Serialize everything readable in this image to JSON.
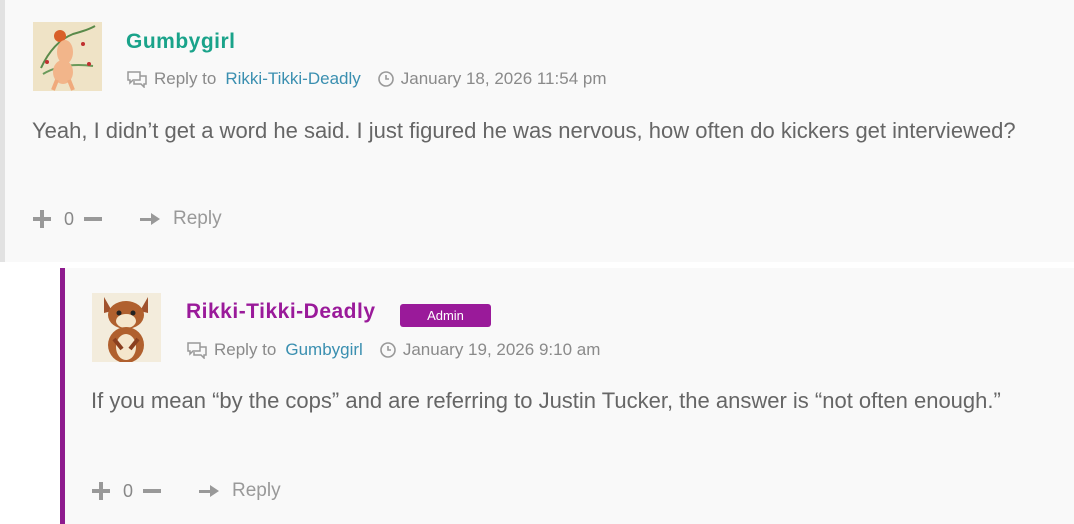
{
  "comments": [
    {
      "author": "Gumbygirl",
      "author_color": "#1aa38a",
      "reply_prefix": "Reply to",
      "reply_to": "Rikki-Tikki-Deadly",
      "date": "January 18, 2026 11:54 pm",
      "text": "Yeah, I didn’t get a word he said. I just figured he was nervous, how often do kickers get interviewed?",
      "votes": "0",
      "reply_label": "Reply"
    },
    {
      "author": "Rikki-Tikki-Deadly",
      "author_color": "#9a1a9a",
      "badge": "Admin",
      "badge_color": "#9a1a9a",
      "reply_prefix": "Reply to",
      "reply_to": "Gumbygirl",
      "date": "January 19, 2026 9:10 am",
      "text": "If you mean “by the cops” and are referring to Justin Tucker, the answer is “not often enough.”",
      "votes": "0",
      "reply_label": "Reply"
    }
  ]
}
